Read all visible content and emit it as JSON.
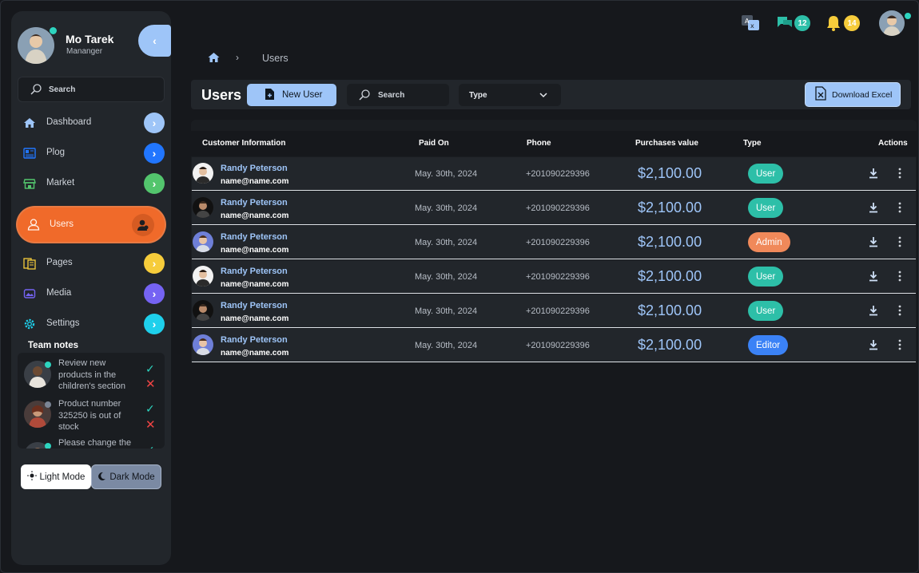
{
  "colors": {
    "accent": "#9ec5f8",
    "active_nav": "#f06a2a",
    "online": "#2dd4bf",
    "user_badge": "#2dbfa8",
    "admin_badge": "#f0895a",
    "editor_badge": "#3b82f6"
  },
  "profile": {
    "name": "Mo Tarek",
    "role": "Mananger",
    "collapse_icon": "chevron-left-icon"
  },
  "sidebar": {
    "search_label": "Search",
    "items": [
      {
        "label": "Dashboard",
        "icon": "home-icon",
        "arrow_color": "#9ec5f8"
      },
      {
        "label": "Plog",
        "icon": "blog-icon",
        "arrow_color": "#2176ff"
      },
      {
        "label": "Market",
        "icon": "store-icon",
        "arrow_color": "#53c56d"
      },
      {
        "label": "Users",
        "icon": "user-icon",
        "active": true
      },
      {
        "label": "Pages",
        "icon": "pages-icon",
        "arrow_color": "#f6cc3b"
      },
      {
        "label": "Media",
        "icon": "media-icon",
        "arrow_color": "#7563f3"
      },
      {
        "label": "Settings",
        "icon": "gear-icon",
        "arrow_color": "#1ed0ec"
      }
    ],
    "team_notes_title": "Team notes",
    "notes": [
      {
        "text": "Review new products in the children's section"
      },
      {
        "text": "Product number 325250 is out of stock"
      },
      {
        "text": "Please change the"
      }
    ],
    "mode": {
      "light": "Light Mode",
      "dark": "Dark Mode"
    }
  },
  "topbar": {
    "messages_count": "12",
    "notifications_count": "14"
  },
  "breadcrumb": {
    "current": "Users"
  },
  "toolbar": {
    "title": "Users",
    "new_user": "New User",
    "search": "Search",
    "type_filter": "Type",
    "download": "Download Excel"
  },
  "table": {
    "headers": [
      "Customer Information",
      "Paid On",
      "Phone",
      "Purchases value",
      "Type",
      "Actions"
    ],
    "rows": [
      {
        "name": "Randy Peterson",
        "email": "name@name.com",
        "paid_on": "May. 30th, 2024",
        "phone": "+201090229396",
        "value": "$2,100.00",
        "type": "User"
      },
      {
        "name": "Randy Peterson",
        "email": "name@name.com",
        "paid_on": "May. 30th, 2024",
        "phone": "+201090229396",
        "value": "$2,100.00",
        "type": "User"
      },
      {
        "name": "Randy Peterson",
        "email": "name@name.com",
        "paid_on": "May. 30th, 2024",
        "phone": "+201090229396",
        "value": "$2,100.00",
        "type": "Admin"
      },
      {
        "name": "Randy Peterson",
        "email": "name@name.com",
        "paid_on": "May. 30th, 2024",
        "phone": "+201090229396",
        "value": "$2,100.00",
        "type": "User"
      },
      {
        "name": "Randy Peterson",
        "email": "name@name.com",
        "paid_on": "May. 30th, 2024",
        "phone": "+201090229396",
        "value": "$2,100.00",
        "type": "User"
      },
      {
        "name": "Randy Peterson",
        "email": "name@name.com",
        "paid_on": "May. 30th, 2024",
        "phone": "+201090229396",
        "value": "$2,100.00",
        "type": "Editor"
      }
    ]
  }
}
